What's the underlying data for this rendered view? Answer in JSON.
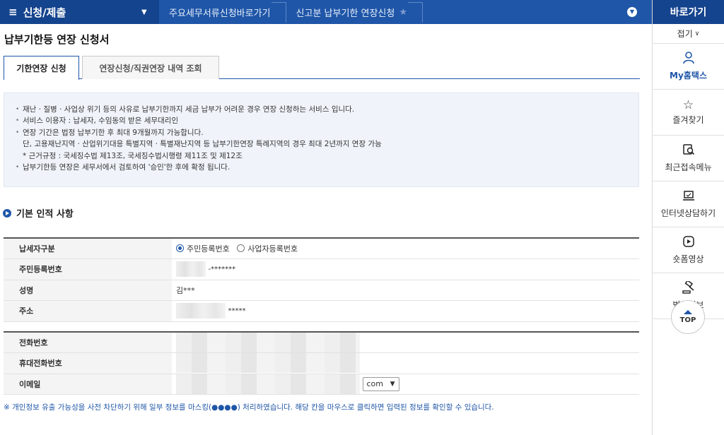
{
  "topbar": {
    "menu_icon": "≡",
    "menu_label": "신청/제출",
    "crumbs": [
      "주요세무서류신청바로가기",
      "신고분 납부기한 연장신청"
    ],
    "star": "★"
  },
  "sidebar": {
    "title": "바로가기",
    "fold": "접기",
    "items": [
      {
        "icon": "person-icon",
        "label": "My홈택스"
      },
      {
        "icon": "star-icon",
        "label": "즐겨찾기"
      },
      {
        "icon": "recent-menu-icon",
        "label": "최근접속메뉴"
      },
      {
        "icon": "laptop-icon",
        "label": "인터넷상담하기"
      },
      {
        "icon": "play-icon",
        "label": "숏폼영상"
      },
      {
        "icon": "gavel-icon",
        "label": "법령정보"
      }
    ],
    "top_label": "TOP"
  },
  "page": {
    "title": "납부기한등 연장 신청서",
    "tabs": [
      "기한연장 신청",
      "연장신청/직권연장 내역 조회"
    ]
  },
  "info": {
    "lines": [
      "재난 · 질병 · 사업상 위기 등의 사유로 납부기한까지 세금 납부가 어려운 경우 연장 신청하는 서비스 입니다.",
      "서비스 이용자 : 납세자, 수임동의 받은 세무대리인",
      "연장 기간은 법정 납부기한 후 최대 9개월까지 가능합니다."
    ],
    "sub1": "단, 고용재난지역 · 산업위기대응 특별지역 · 특별재난지역 등 납부기한연장 특례지역의 경우 최대 2년까지 연장 가능",
    "sub2": "* 근거규정 : 국세징수법 제13조, 국세징수법시행령 제11조 및 제12조",
    "last": "납부기한등 연장은 세무서에서 검토하여 '승인'한 후에 확정 됩니다."
  },
  "section": {
    "title": "기본 인적 사항"
  },
  "form": {
    "taxpayer_type_label": "납세자구분",
    "options": [
      "주민등록번호",
      "사업자등록번호"
    ],
    "rrn_label": "주민등록번호",
    "rrn_value": "-*******",
    "name_label": "성명",
    "name_value": "김***",
    "address_label": "주소",
    "address_value": "*****",
    "phone_label": "전화번호",
    "mobile_label": "휴대전화번호",
    "email_label": "이메일",
    "email_domain": "com"
  },
  "notice": "※ 개인정보 유출 가능성을 사전 차단하기 위해 일부 정보를 마스킹(●●●●) 처리하였습니다. 해당 칸을 마우스로 클릭하면 입력된 정보를 확인할 수 있습니다."
}
